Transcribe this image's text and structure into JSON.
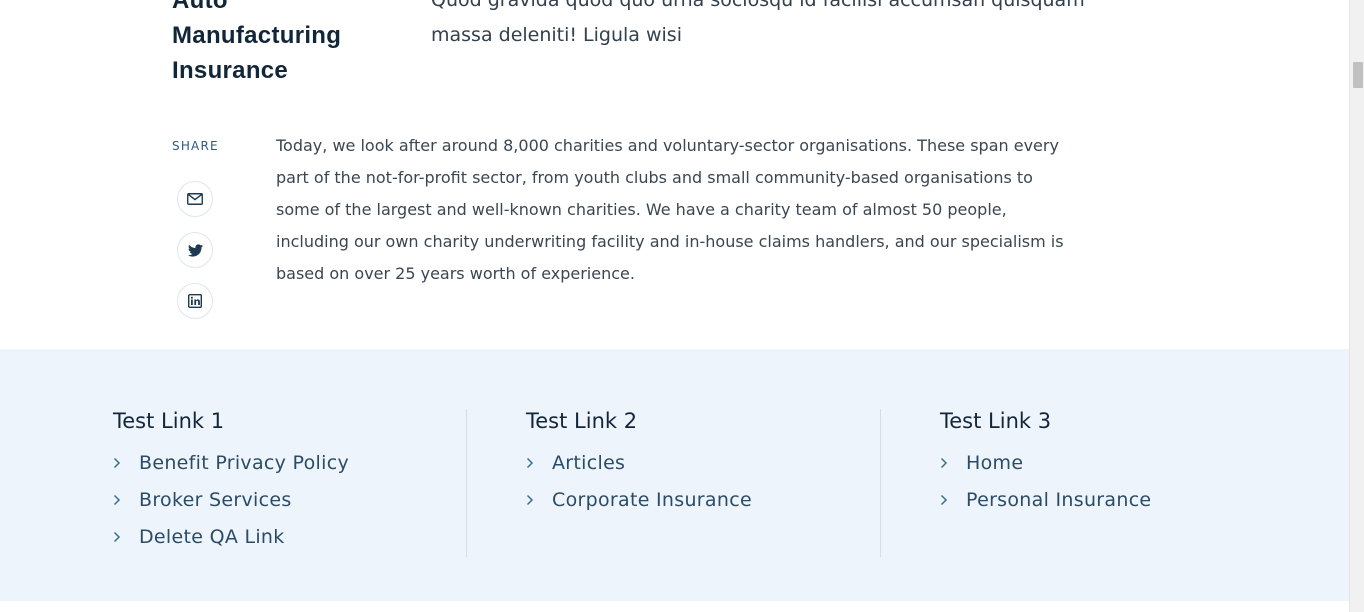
{
  "article": {
    "title_lines": [
      "Auto",
      "Manufacturing",
      "Insurance"
    ],
    "intro": "Quod gravida quod quo urna sociosqu id facilisi accumsan quisquam massa deleniti! Ligula wisi",
    "share_label": "SHARE",
    "share_buttons": [
      "email-icon",
      "twitter-icon",
      "linkedin-icon"
    ],
    "body": "Today, we look after around 8,000 charities and voluntary-sector organisations. These span every part of the not-for-profit sector, from youth clubs and small community-based organisations to some of the largest and well-known charities. We have a charity team of almost 50 people, including our own charity underwriting facility and in-house claims handlers, and our specialism is based on over 25 years worth of experience."
  },
  "footer": {
    "columns": [
      {
        "title": "Test Link 1",
        "links": [
          "Benefit Privacy Policy",
          "Broker Services",
          "Delete QA Link"
        ]
      },
      {
        "title": "Test Link 2",
        "links": [
          "Articles",
          "Corporate Insurance"
        ]
      },
      {
        "title": "Test Link 3",
        "links": [
          "Home",
          "Personal Insurance"
        ]
      }
    ]
  },
  "colors": {
    "footer_bg": "#eef4fb",
    "heading": "#12263a",
    "link": "#2b4c66",
    "accent": "#3a6f93"
  }
}
